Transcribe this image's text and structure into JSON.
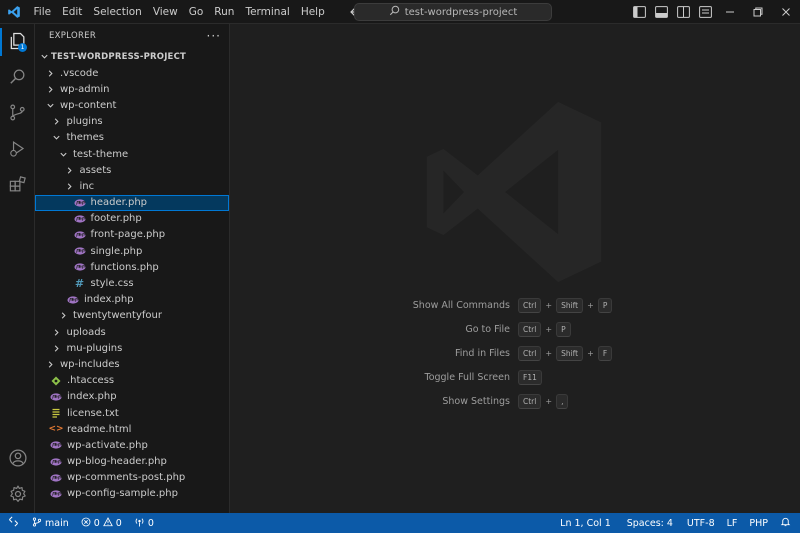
{
  "menu": [
    "File",
    "Edit",
    "Selection",
    "View",
    "Go",
    "Run",
    "Terminal",
    "Help"
  ],
  "command_center": "test-wordpress-project",
  "explorer": {
    "title": "EXPLORER",
    "root": "TEST-WORDPRESS-PROJECT",
    "rows": [
      {
        "label": ".vscode",
        "depth": 1,
        "type": "folder",
        "open": false
      },
      {
        "label": "wp-admin",
        "depth": 1,
        "type": "folder",
        "open": false
      },
      {
        "label": "wp-content",
        "depth": 1,
        "type": "folder",
        "open": true
      },
      {
        "label": "plugins",
        "depth": 2,
        "type": "folder",
        "open": false
      },
      {
        "label": "themes",
        "depth": 2,
        "type": "folder",
        "open": true
      },
      {
        "label": "test-theme",
        "depth": 3,
        "type": "folder",
        "open": true
      },
      {
        "label": "assets",
        "depth": 4,
        "type": "folder",
        "open": false
      },
      {
        "label": "inc",
        "depth": 4,
        "type": "folder",
        "open": false
      },
      {
        "label": "header.php",
        "depth": 4,
        "type": "php",
        "selected": true
      },
      {
        "label": "footer.php",
        "depth": 4,
        "type": "php"
      },
      {
        "label": "front-page.php",
        "depth": 4,
        "type": "php"
      },
      {
        "label": "single.php",
        "depth": 4,
        "type": "php"
      },
      {
        "label": "functions.php",
        "depth": 4,
        "type": "php"
      },
      {
        "label": "style.css",
        "depth": 4,
        "type": "css"
      },
      {
        "label": "index.php",
        "depth": 3,
        "type": "php"
      },
      {
        "label": "twentytwentyfour",
        "depth": 3,
        "type": "folder",
        "open": false
      },
      {
        "label": "uploads",
        "depth": 2,
        "type": "folder",
        "open": false
      },
      {
        "label": "mu-plugins",
        "depth": 2,
        "type": "folder",
        "open": false
      },
      {
        "label": "wp-includes",
        "depth": 1,
        "type": "folder",
        "open": false
      },
      {
        "label": ".htaccess",
        "depth": 1,
        "type": "htaccess"
      },
      {
        "label": "index.php",
        "depth": 1,
        "type": "php"
      },
      {
        "label": "license.txt",
        "depth": 1,
        "type": "txt"
      },
      {
        "label": "readme.html",
        "depth": 1,
        "type": "html"
      },
      {
        "label": "wp-activate.php",
        "depth": 1,
        "type": "php"
      },
      {
        "label": "wp-blog-header.php",
        "depth": 1,
        "type": "php"
      },
      {
        "label": "wp-comments-post.php",
        "depth": 1,
        "type": "php"
      },
      {
        "label": "wp-config-sample.php",
        "depth": 1,
        "type": "php"
      }
    ]
  },
  "shortcuts": [
    {
      "label": "Show All Commands",
      "keys": [
        "Ctrl",
        "Shift",
        "P"
      ]
    },
    {
      "label": "Go to File",
      "keys": [
        "Ctrl",
        "P"
      ]
    },
    {
      "label": "Find in Files",
      "keys": [
        "Ctrl",
        "Shift",
        "F"
      ]
    },
    {
      "label": "Toggle Full Screen",
      "keys": [
        "F11"
      ]
    },
    {
      "label": "Show Settings",
      "keys": [
        "Ctrl",
        ","
      ]
    }
  ],
  "status": {
    "branch": "main",
    "errors": "0",
    "warnings": "0",
    "ports": "0",
    "position": "Ln 1, Col 1",
    "spaces": "Spaces: 4",
    "encoding": "UTF-8",
    "eol": "LF",
    "language": "PHP"
  },
  "activity_badge": "1",
  "colors": {
    "accent": "#0078d4",
    "statusbar": "#0c5aa8",
    "php_icon": "#a074c4",
    "css_icon": "#519aba",
    "html_icon": "#e37933",
    "htaccess_icon": "#8dc149",
    "txt_icon": "#cbcb41"
  }
}
